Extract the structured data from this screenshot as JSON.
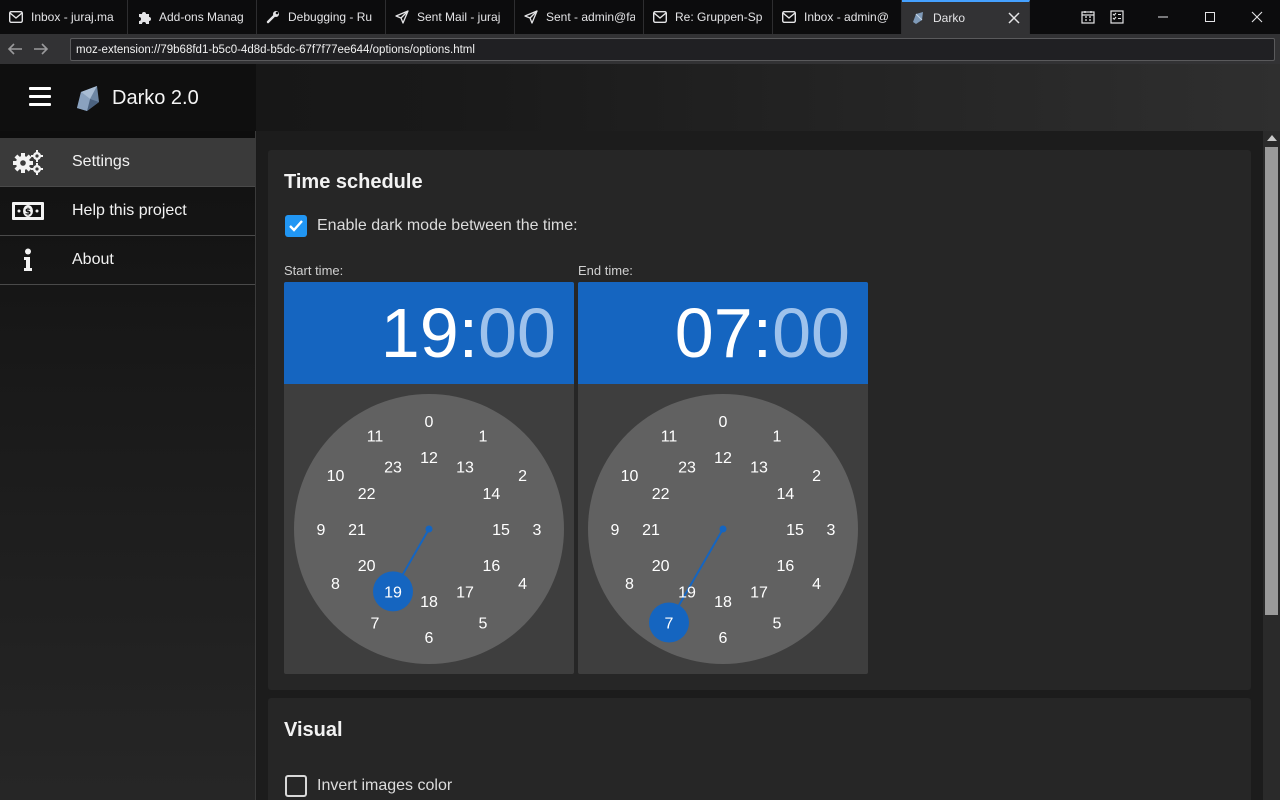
{
  "browser": {
    "tabs": [
      {
        "label": "Inbox - juraj.ma",
        "icon": "envelope-icon"
      },
      {
        "label": "Add-ons Manag",
        "icon": "puzzle-icon"
      },
      {
        "label": "Debugging - Ru",
        "icon": "wrench-icon"
      },
      {
        "label": "Sent Mail - juraj",
        "icon": "paper-plane-icon"
      },
      {
        "label": "Sent - admin@fa",
        "icon": "paper-plane-icon"
      },
      {
        "label": "Re: Gruppen-Sp",
        "icon": "envelope-icon"
      },
      {
        "label": "Inbox - admin@",
        "icon": "envelope-icon"
      },
      {
        "label": "Darko",
        "icon": "darko-icon"
      }
    ],
    "url": "moz-extension://79b68fd1-b5c0-4d8d-b5dc-67f7f77ee644/options/options.html"
  },
  "app": {
    "title": "Darko 2.0"
  },
  "sidebar": {
    "items": [
      {
        "label": "Settings",
        "icon": "gears-icon",
        "active": true
      },
      {
        "label": "Help this project",
        "icon": "money-icon",
        "active": false
      },
      {
        "label": "About",
        "icon": "info-icon",
        "active": false
      }
    ]
  },
  "time_schedule": {
    "title": "Time schedule",
    "enable_label": "Enable dark mode between the time:",
    "enabled": true,
    "start": {
      "label": "Start time:",
      "hours": "19",
      "colon": ":",
      "minutes": "00",
      "selected_hour": 19
    },
    "end": {
      "label": "End time:",
      "hours": "07",
      "colon": ":",
      "minutes": "00",
      "selected_hour": 7
    }
  },
  "visual": {
    "title": "Visual",
    "invert_label": "Invert images color",
    "invert_enabled": false
  },
  "colors": {
    "accent": "#1565c0",
    "checkbox": "#2196f3",
    "clock_face": "#616161",
    "picker_bg": "#3e3e3e"
  }
}
